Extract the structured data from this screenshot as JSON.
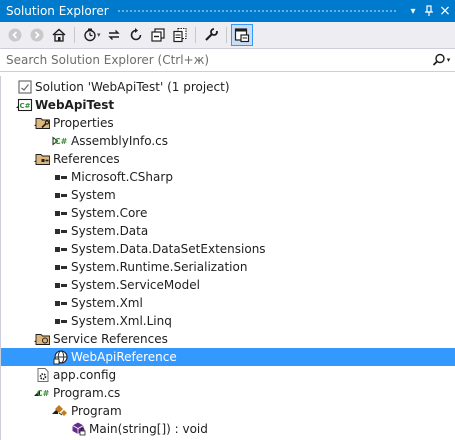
{
  "window": {
    "title": "Solution Explorer",
    "controls": {
      "dropdown": "▾",
      "pin": "ᛘ",
      "close": "×"
    }
  },
  "toolbar": {
    "buttons": [
      {
        "icon": "back-icon"
      },
      {
        "icon": "forward-icon"
      },
      {
        "icon": "home-icon"
      },
      {
        "icon": "pending-changes-filter-icon"
      },
      {
        "icon": "sync-with-active-document-icon"
      },
      {
        "icon": "refresh-icon"
      },
      {
        "icon": "collapse-all-icon"
      },
      {
        "icon": "show-all-files-icon"
      },
      {
        "icon": "properties-icon"
      },
      {
        "icon": "preview-selected-items-icon",
        "active": true
      }
    ]
  },
  "search": {
    "placeholder": "Search Solution Explorer (Ctrl+ж)",
    "value": ""
  },
  "tree": [
    {
      "label": "Solution 'WebApiTest' (1 project)",
      "level": 0,
      "expander": "none",
      "icon": "solution-icon"
    },
    {
      "label": "WebApiTest",
      "level": 0,
      "expander": "expanded",
      "icon": "csharp-project-icon",
      "bold": true
    },
    {
      "label": "Properties",
      "level": 1,
      "expander": "expanded",
      "icon": "properties-folder-icon"
    },
    {
      "label": "AssemblyInfo.cs",
      "level": 2,
      "expander": "collapsed",
      "icon": "csharp-file-icon"
    },
    {
      "label": "References",
      "level": 1,
      "expander": "expanded",
      "icon": "references-folder-icon"
    },
    {
      "label": "Microsoft.CSharp",
      "level": 2,
      "expander": "none",
      "icon": "reference-icon"
    },
    {
      "label": "System",
      "level": 2,
      "expander": "none",
      "icon": "reference-icon"
    },
    {
      "label": "System.Core",
      "level": 2,
      "expander": "none",
      "icon": "reference-icon"
    },
    {
      "label": "System.Data",
      "level": 2,
      "expander": "none",
      "icon": "reference-icon"
    },
    {
      "label": "System.Data.DataSetExtensions",
      "level": 2,
      "expander": "none",
      "icon": "reference-icon"
    },
    {
      "label": "System.Runtime.Serialization",
      "level": 2,
      "expander": "none",
      "icon": "reference-icon"
    },
    {
      "label": "System.ServiceModel",
      "level": 2,
      "expander": "none",
      "icon": "reference-icon"
    },
    {
      "label": "System.Xml",
      "level": 2,
      "expander": "none",
      "icon": "reference-icon"
    },
    {
      "label": "System.Xml.Linq",
      "level": 2,
      "expander": "none",
      "icon": "reference-icon"
    },
    {
      "label": "Service References",
      "level": 1,
      "expander": "expanded",
      "icon": "service-references-folder-icon"
    },
    {
      "label": "WebApiReference",
      "level": 2,
      "expander": "none",
      "icon": "service-reference-icon",
      "selected": true
    },
    {
      "label": "app.config",
      "level": 1,
      "expander": "none",
      "icon": "config-file-icon"
    },
    {
      "label": "Program.cs",
      "level": 1,
      "expander": "expanded",
      "icon": "csharp-file-icon"
    },
    {
      "label": "Program",
      "level": 2,
      "expander": "expanded",
      "icon": "class-icon"
    },
    {
      "label": "Main(string[]) : void",
      "level": 3,
      "expander": "none",
      "icon": "private-method-icon"
    }
  ],
  "colors": {
    "titlebar": "#007acc",
    "toolbar": "#eeeef2",
    "selection": "#3399ff",
    "folder": "#dcb67a",
    "csharp_green": "#388a34",
    "method_purple": "#652d90",
    "class_orange": "#c27d1a"
  }
}
